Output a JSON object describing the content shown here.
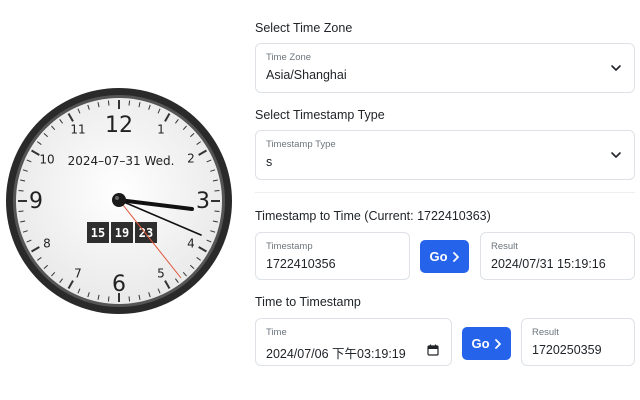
{
  "clock": {
    "date": "2024–07–31 Wed.",
    "digits": [
      "15",
      "19",
      "23"
    ],
    "numbers_large": [
      "12",
      "3",
      "6",
      "9"
    ],
    "numbers_small": [
      "1",
      "2",
      "4",
      "5",
      "7",
      "8",
      "10",
      "11"
    ],
    "colors": {
      "rim": "#222222",
      "face": "#f6f6f6",
      "second_hand": "#e0573a",
      "digit_bg": "#2e2e2e"
    }
  },
  "timezone_section": {
    "title": "Select Time Zone",
    "label": "Time Zone",
    "value": "Asia/Shanghai"
  },
  "timestamp_type_section": {
    "title": "Select Timestamp Type",
    "label": "Timestamp Type",
    "value": "s"
  },
  "ts_to_time": {
    "title": "Timestamp to Time (Current: 1722410363)",
    "input_label": "Timestamp",
    "input_value": "1722410356",
    "go_label": "Go",
    "result_label": "Result",
    "result_value": "2024/07/31 15:19:16"
  },
  "time_to_ts": {
    "title": "Time to Timestamp",
    "input_label": "Time",
    "input_value": "2024/07/06 下午03:19:19",
    "go_label": "Go",
    "result_label": "Result",
    "result_value": "1720250359"
  },
  "colors": {
    "accent": "#2563eb",
    "border": "#dee2e6",
    "label": "#6c757d"
  }
}
